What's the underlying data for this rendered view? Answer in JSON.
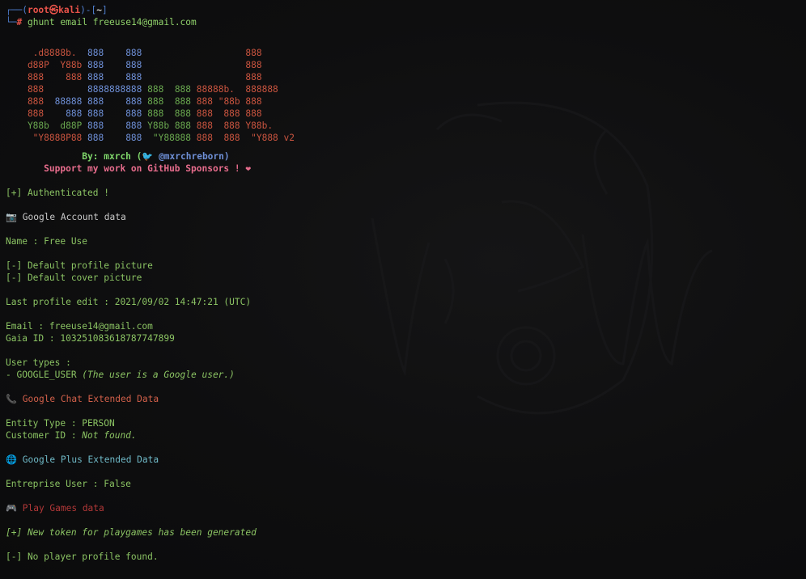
{
  "prompt": {
    "frame_top_left": "┌──(",
    "user": "root",
    "at": "㉿",
    "host": "kali",
    "frame_mid": ")-[",
    "dir": "~",
    "frame_end": "]",
    "frame_bottom": "└─",
    "hash": "#",
    "command": " ghunt email freeuse14@gmail.com"
  },
  "banner": {
    "lines": [
      [
        {
          "t": "     .d8888b.  ",
          "c": "rd"
        },
        {
          "t": "888    888",
          "c": "bl"
        },
        {
          "t": "                   ",
          "c": "g"
        },
        {
          "t": "888",
          "c": "rd"
        }
      ],
      [
        {
          "t": "    d88P  Y88b ",
          "c": "rd"
        },
        {
          "t": "888    888",
          "c": "bl"
        },
        {
          "t": "                   ",
          "c": "g"
        },
        {
          "t": "888",
          "c": "rd"
        }
      ],
      [
        {
          "t": "    888    888 ",
          "c": "rd"
        },
        {
          "t": "888    888",
          "c": "bl"
        },
        {
          "t": "                   ",
          "c": "g"
        },
        {
          "t": "888",
          "c": "rd"
        }
      ],
      [
        {
          "t": "    888        ",
          "c": "rd"
        },
        {
          "t": "8888888888",
          "c": "bl"
        },
        {
          "t": " 888  888 ",
          "c": "g"
        },
        {
          "t": "88888b.  888888",
          "c": "rd"
        }
      ],
      [
        {
          "t": "    888  ",
          "c": "rd"
        },
        {
          "t": "88888 ",
          "c": "bl"
        },
        {
          "t": "888    888",
          "c": "bl"
        },
        {
          "t": " 888  888 ",
          "c": "g"
        },
        {
          "t": "888 \"88b 888",
          "c": "rd"
        }
      ],
      [
        {
          "t": "    888    ",
          "c": "rd"
        },
        {
          "t": "888 888    888",
          "c": "bl"
        },
        {
          "t": " 888  888 ",
          "c": "g"
        },
        {
          "t": "888  888 888",
          "c": "rd"
        }
      ],
      [
        {
          "t": "    Y88b  d88P ",
          "c": "g"
        },
        {
          "t": "888    888",
          "c": "bl"
        },
        {
          "t": " Y88b 888 ",
          "c": "g"
        },
        {
          "t": "888  888 Y88b.",
          "c": "rd"
        }
      ],
      [
        {
          "t": "     \"Y8888P88 ",
          "c": "rd"
        },
        {
          "t": "888    888",
          "c": "bl"
        },
        {
          "t": "  \"Y88888 ",
          "c": "g"
        },
        {
          "t": "888  888  \"Y888 v2",
          "c": "rd"
        }
      ]
    ],
    "by_label": "By: mxrch (",
    "bird_glyph": "🐦",
    "handle": " @mxrchreborn)",
    "support": "Support my work on GitHub Sponsors ! ",
    "heart_glyph": "❤"
  },
  "output": {
    "authenticated": "[+] Authenticated !",
    "account_icon": "📷",
    "account_header": " Google Account data",
    "name": "Name : Free Use",
    "default_profile": "[-] Default profile picture",
    "default_cover": "[-] Default cover picture",
    "last_edit": "Last profile edit : 2021/09/02 14:47:21 (UTC)",
    "email": "Email : freeuse14@gmail.com",
    "gaia": "Gaia ID : 103251083618787747899",
    "user_types_label": "User types :",
    "user_type_prefix": "- GOOGLE_USER ",
    "user_type_note": "(The user is a Google user.)",
    "chat_icon": "📞",
    "chat_header": " Google Chat Extended Data",
    "entity_type": "Entity Type : PERSON",
    "customer_prefix": "Customer ID : ",
    "customer_value": "Not found.",
    "plus_icon": "🌐",
    "plus_header": " Google Plus Extended Data",
    "enterprise": "Entreprise User : False",
    "games_icon": "🎮",
    "games_header": " Play Games data",
    "new_token": "[+] New token for playgames has been generated",
    "no_player": "[-] No player profile found."
  }
}
